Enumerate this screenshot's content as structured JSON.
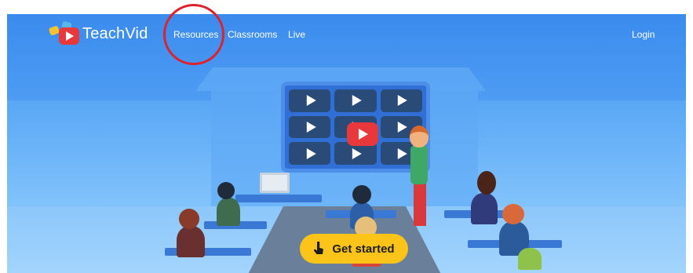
{
  "header": {
    "brand": "TeachVid",
    "nav": [
      "Resources",
      "Classrooms",
      "Live"
    ],
    "login": "Login"
  },
  "hero": {
    "cta_label": "Get started",
    "cta_icon": "hand-pointer-icon"
  },
  "colors": {
    "hero_blue": "#3d8ef0",
    "cta_yellow": "#fcc419",
    "logo_red": "#e8383b",
    "highlight_red": "#e0202a"
  }
}
